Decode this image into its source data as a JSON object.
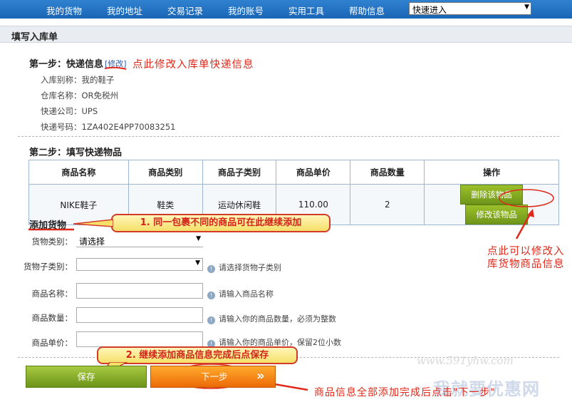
{
  "nav": {
    "items": [
      "我的货物",
      "我的地址",
      "交易记录",
      "我的账号",
      "实用工具",
      "帮助信息"
    ],
    "quick_select": "快速进入"
  },
  "page_title": "填写入库单",
  "step1": {
    "title": "第一步：快递信息",
    "edit_link": "[修改]",
    "annotation": "点此修改入库单快递信息",
    "rows": [
      {
        "label": "入库别称：",
        "value": "我的鞋子"
      },
      {
        "label": "仓库名称：",
        "value": "OR免税州"
      },
      {
        "label": "快递公司：",
        "value": "UPS"
      },
      {
        "label": "快递号码：",
        "value": "1ZA402E4PP70083251"
      }
    ]
  },
  "step2": {
    "title": "第二步：填写快递物品",
    "table": {
      "headers": [
        "商品名称",
        "商品类别",
        "商品子类别",
        "商品单价",
        "商品数量",
        "操作"
      ],
      "row": [
        "NIKE鞋子",
        "鞋类",
        "运动休闲鞋",
        "110.00",
        "2"
      ],
      "delete_label": "删除该物品",
      "modify_label": "修改该物品"
    },
    "modify_annotation_line1": "点此可以修改入",
    "modify_annotation_line2": "库货物商品信息"
  },
  "add_goods": {
    "title": "添加货物",
    "callout1": "1. 同一包裹不同的商品可在此继续添加",
    "fields": {
      "category_label": "货物类别：",
      "category_value": "请选择",
      "subcategory_label": "货物子类别：",
      "subcategory_hint": "请选择货物子类别",
      "name_label": "商品名称：",
      "name_hint": "请输入商品名称",
      "qty_label": "商品数量：",
      "qty_hint": "请输入你的商品数量，必须为整数",
      "price_label": "商品单价：",
      "price_hint": "请输入你的商品单价，保留2位小数"
    },
    "callout2": "2. 继续添加商品信息完成后点保存"
  },
  "buttons": {
    "save": "保存",
    "next": "下一步",
    "next_chevron": "»",
    "next_annotation": "商品信息全部添加完成后点击\"下一步\""
  },
  "watermark": {
    "url": "www.591yhw.com",
    "brand": "我就要优惠网"
  },
  "colors": {
    "nav": "#2f82cf",
    "red_annotation": "#e0291a",
    "green_button": "#8bb126",
    "orange_button": "#f58514"
  }
}
